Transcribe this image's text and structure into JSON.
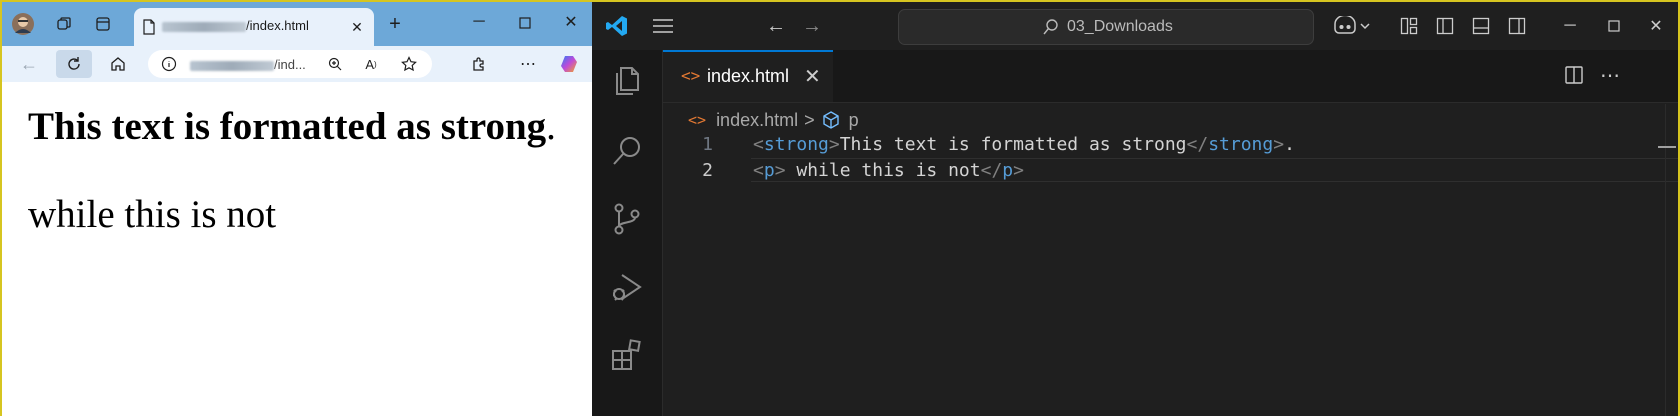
{
  "browser": {
    "tab_title": "/index.html",
    "address_text": "/ind...",
    "content": {
      "strong_text": "This text is formatted as strong",
      "trailing": ".",
      "paragraph": "while this is not"
    }
  },
  "vscode": {
    "search_text": "03_Downloads",
    "tab_name": "index.html",
    "breadcrumb": {
      "file": "index.html",
      "separator": ">",
      "symbol": "p"
    },
    "lines": [
      {
        "num": "1",
        "parts": [
          {
            "t": "<",
            "c": "tagb"
          },
          {
            "t": "strong",
            "c": "tagn"
          },
          {
            "t": ">",
            "c": "tagb"
          },
          {
            "t": "This text is formatted as strong",
            "c": "txt"
          },
          {
            "t": "</",
            "c": "tagb"
          },
          {
            "t": "strong",
            "c": "tagn"
          },
          {
            "t": ">",
            "c": "tagb"
          },
          {
            "t": ".",
            "c": "txt"
          }
        ]
      },
      {
        "num": "2",
        "parts": [
          {
            "t": "<",
            "c": "tagb"
          },
          {
            "t": "p",
            "c": "tagn"
          },
          {
            "t": ">",
            "c": "tagb"
          },
          {
            "t": " while this is not",
            "c": "txt"
          },
          {
            "t": "</",
            "c": "tagb"
          },
          {
            "t": "p",
            "c": "tagn"
          },
          {
            "t": ">",
            "c": "tagb"
          }
        ]
      }
    ]
  },
  "colors": {
    "desktop_border": "#d6c520",
    "browser_titlebar": "#6da8d8",
    "vscode_bg": "#1f1f1f",
    "vscode_accent": "#0078d4",
    "tag_name": "#569cd6",
    "html_icon": "#e37933"
  }
}
